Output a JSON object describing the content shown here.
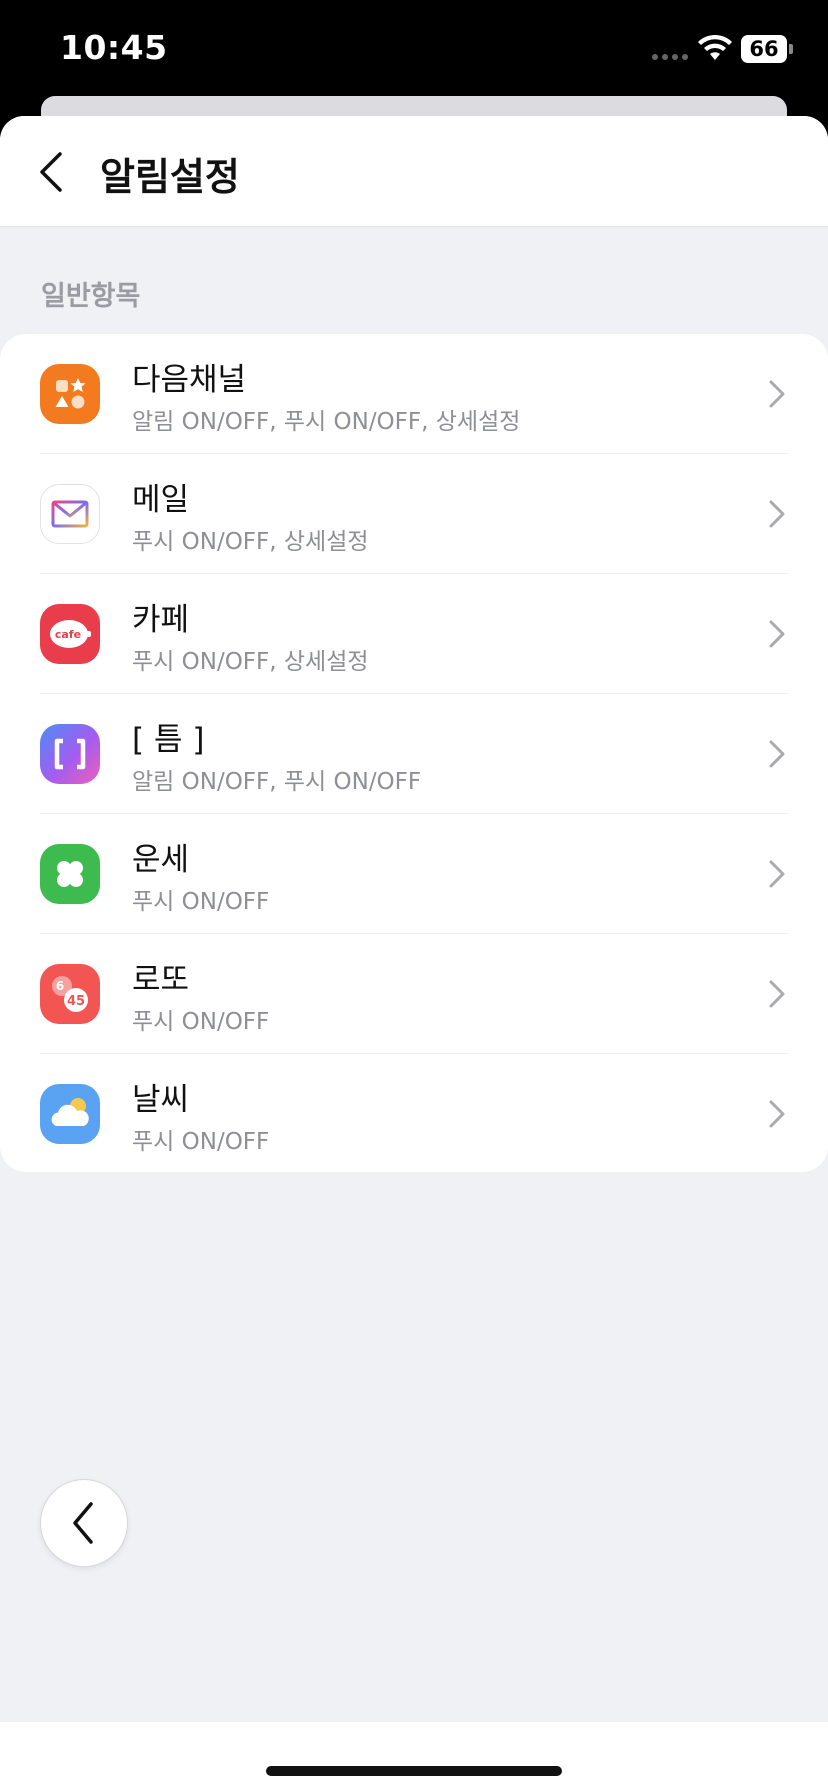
{
  "status_bar": {
    "time": "10:45",
    "battery": "66"
  },
  "nav": {
    "title": "알림설정"
  },
  "section": {
    "header": "일반항목"
  },
  "items": [
    {
      "title": "다음채널",
      "subtitle": "알림 ON/OFF, 푸시 ON/OFF, 상세설정",
      "icon": "daum-channel-icon"
    },
    {
      "title": "메일",
      "subtitle": "푸시 ON/OFF, 상세설정",
      "icon": "mail-icon"
    },
    {
      "title": "카페",
      "subtitle": "푸시 ON/OFF, 상세설정",
      "icon": "cafe-icon",
      "icon_text": "cafe"
    },
    {
      "title": "[ 틈 ]",
      "subtitle": "알림 ON/OFF, 푸시 ON/OFF",
      "icon": "teum-icon"
    },
    {
      "title": "운세",
      "subtitle": "푸시 ON/OFF",
      "icon": "fortune-clover-icon"
    },
    {
      "title": "로또",
      "subtitle": "푸시 ON/OFF",
      "icon": "lotto-icon",
      "icon_text_a": "6",
      "icon_text_b": "45"
    },
    {
      "title": "날씨",
      "subtitle": "푸시 ON/OFF",
      "icon": "weather-icon"
    }
  ],
  "colors": {
    "daum_channel": "#f47a1f",
    "cafe": "#ea3d4b",
    "fortune": "#3dbb4e",
    "lotto": "#f25552",
    "weather": "#5aa2f2"
  }
}
